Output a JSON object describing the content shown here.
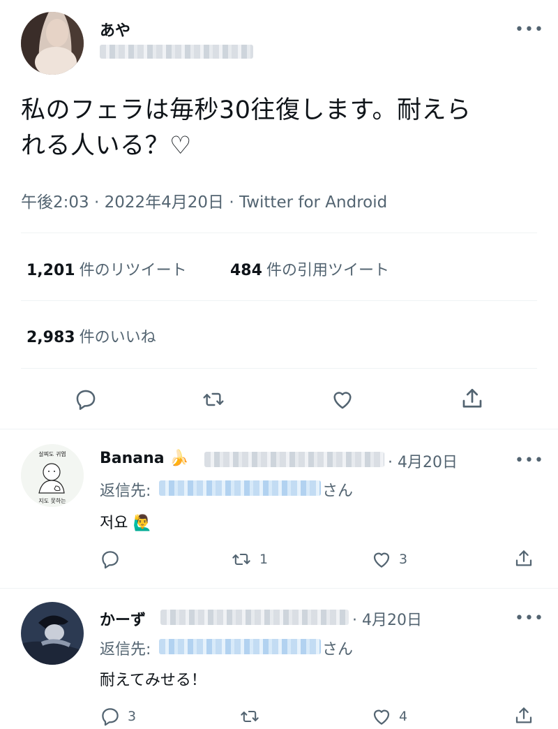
{
  "main_tweet": {
    "display_name": "あや",
    "text_line1": "私のフェラは毎秒30往復します。耐えら",
    "text_line2": "れる人いる？♡",
    "time": "午後2:03",
    "date": "2022年4月20日",
    "separator": "·",
    "source": "Twitter for Android",
    "retweets_count": "1,201",
    "retweets_label": "件のリツイート",
    "quotes_count": "484",
    "quotes_label": "件の引用ツイート",
    "likes_count": "2,983",
    "likes_label": "件のいいね"
  },
  "replies": [
    {
      "display_name": "Banana",
      "name_emoji": "🍌",
      "date": "4月20日",
      "reply_to_label": "返信先:",
      "reply_to_suffix": "さん",
      "text": "저요",
      "text_emoji": "🙋‍♂️",
      "avatar_text_top": "살찌도 귀엽",
      "avatar_text_bottom": "지도 못하는",
      "reply_count": "",
      "retweet_count": "1",
      "like_count": "3"
    },
    {
      "display_name": "かーず",
      "date": "4月20日",
      "reply_to_label": "返信先:",
      "reply_to_suffix": "さん",
      "text": "耐えてみせる！",
      "reply_count": "3",
      "retweet_count": "",
      "like_count": "4"
    }
  ],
  "more_label": "•••",
  "colors": {
    "text": "#0f1419",
    "muted": "#536471",
    "divider": "#eff3f4",
    "link_blue": "#1d9bf0"
  },
  "icons": [
    "reply-icon",
    "retweet-icon",
    "like-icon",
    "share-icon",
    "more-icon"
  ]
}
